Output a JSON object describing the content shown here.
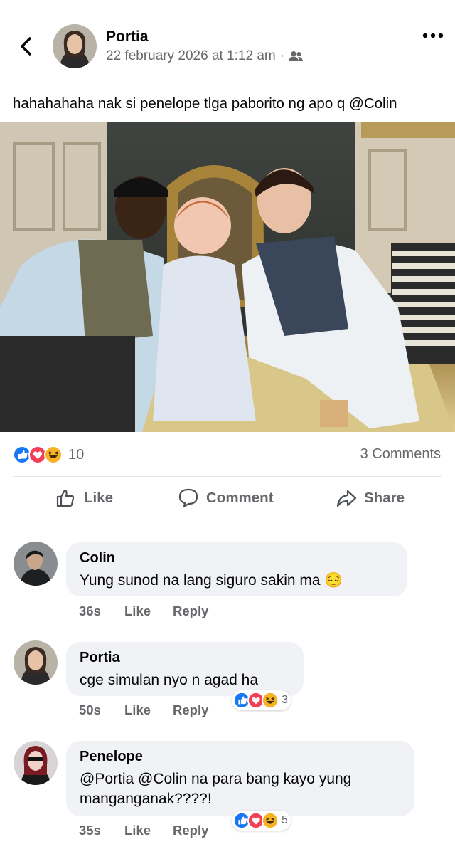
{
  "post": {
    "author": "Portia",
    "timestamp": "22 february 2026 at 1:12 am",
    "separator": "·",
    "audience_icon": "friends-icon",
    "text": "hahahahaha nak si penelope tlga paborito ng apo q @Colin",
    "reaction_count": "10",
    "comments_count": "3 Comments"
  },
  "actions": {
    "like": "Like",
    "comment": "Comment",
    "share": "Share"
  },
  "comments": [
    {
      "name": "Colin",
      "text": "Yung sunod na lang siguro sakin ma",
      "emoji": "😔",
      "time": "36s",
      "like": "Like",
      "reply": "Reply"
    },
    {
      "name": "Portia",
      "text": "cge simulan nyo n agad ha",
      "time": "50s",
      "like": "Like",
      "reply": "Reply",
      "reactions": "3"
    },
    {
      "name": "Penelope",
      "text_line1": "@Portia @Colin na para bang kayo yung",
      "text_line2": "manganganak????!",
      "time": "35s",
      "like": "Like",
      "reply": "Reply",
      "reactions": "5"
    }
  ],
  "colors": {
    "like_blue": "#1877f2",
    "love_red": "#f33e58",
    "haha_yellow": "#f7b125",
    "bubble_gray": "#f0f2f5",
    "meta_gray": "#65676b"
  }
}
